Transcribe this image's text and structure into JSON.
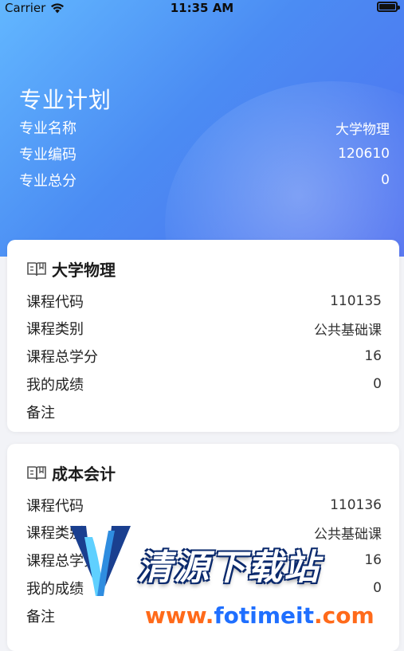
{
  "status_bar": {
    "carrier": "Carrier",
    "time": "11:35 AM",
    "battery_level": 1.0
  },
  "header": {
    "title": "专业计划",
    "rows": [
      {
        "label": "专业名称",
        "value": "大学物理"
      },
      {
        "label": "专业编码",
        "value": "120610"
      },
      {
        "label": "专业总分",
        "value": "0"
      }
    ]
  },
  "courses": [
    {
      "name": "大学物理",
      "icon": "book-icon",
      "rows": [
        {
          "label": "课程代码",
          "value": "110135"
        },
        {
          "label": "课程类别",
          "value": "公共基础课"
        },
        {
          "label": "课程总学分",
          "value": "16"
        },
        {
          "label": "我的成绩",
          "value": "0"
        },
        {
          "label": "备注",
          "value": ""
        }
      ]
    },
    {
      "name": "成本会计",
      "icon": "book-icon",
      "rows": [
        {
          "label": "课程代码",
          "value": "110136"
        },
        {
          "label": "课程类别",
          "value": "公共基础课"
        },
        {
          "label": "课程总学分",
          "value": "16"
        },
        {
          "label": "我的成绩",
          "value": "0"
        },
        {
          "label": "备注",
          "value": ""
        }
      ]
    }
  ],
  "watermark": {
    "text": "清源下载站",
    "url_prefix": "www.",
    "url_domain": "fotimeit",
    "url_suffix": ".com"
  },
  "colors": {
    "hero_start": "#62b7ff",
    "hero_end": "#4f6ff0",
    "background": "#f2f3f7"
  }
}
